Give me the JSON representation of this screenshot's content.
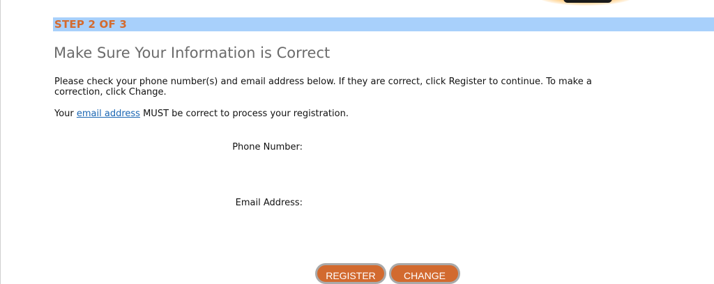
{
  "step": {
    "label": "STEP 2 OF 3"
  },
  "title": "Make Sure Your Information is Correct",
  "instructions": "Please check your phone number(s) and email address below. If they are correct, click Register to continue. To make a correction, click Change.",
  "email_note": {
    "prefix": "Your ",
    "link_text": "email address",
    "suffix": " MUST be correct to process your registration."
  },
  "fields": {
    "phone_label": "Phone Number:",
    "phone_value": "",
    "email_label": "Email Address:",
    "email_value": ""
  },
  "buttons": {
    "register": "REGISTER",
    "change": "CHANGE"
  },
  "colors": {
    "step_bar": "#a8d0fb",
    "step_text": "#d46a2e",
    "button_bg": "#d26a2f",
    "link": "#1a66b3"
  }
}
